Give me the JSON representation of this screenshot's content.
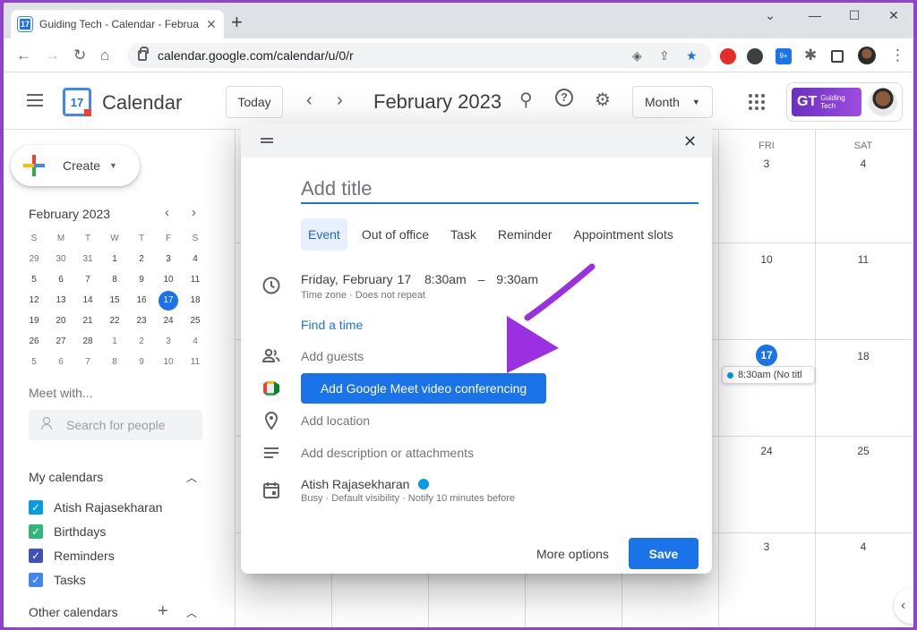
{
  "browser": {
    "tab_title": "Guiding Tech - Calendar - Februa",
    "favicon_text": "17",
    "url": "calendar.google.com/calendar/u/0/r",
    "extension_badge": "9+"
  },
  "header": {
    "app_name": "Calendar",
    "logo_day": "17",
    "today_label": "Today",
    "month_title": "February 2023",
    "view_label": "Month",
    "brand_name": "Guiding Tech"
  },
  "sidebar": {
    "create_label": "Create",
    "mini_title": "February 2023",
    "dow": [
      "S",
      "M",
      "T",
      "W",
      "T",
      "F",
      "S"
    ],
    "weeks": [
      [
        "29",
        "30",
        "31",
        "1",
        "2",
        "3",
        "4"
      ],
      [
        "5",
        "6",
        "7",
        "8",
        "9",
        "10",
        "11"
      ],
      [
        "12",
        "13",
        "14",
        "15",
        "16",
        "17",
        "18"
      ],
      [
        "19",
        "20",
        "21",
        "22",
        "23",
        "24",
        "25"
      ],
      [
        "26",
        "27",
        "28",
        "1",
        "2",
        "3",
        "4"
      ],
      [
        "5",
        "6",
        "7",
        "8",
        "9",
        "10",
        "11"
      ]
    ],
    "meet_with": "Meet with...",
    "search_people_placeholder": "Search for people",
    "my_calendars_title": "My calendars",
    "my_calendars": [
      {
        "label": "Atish Rajasekharan",
        "color": "#039be5"
      },
      {
        "label": "Birthdays",
        "color": "#33b679"
      },
      {
        "label": "Reminders",
        "color": "#3f51b5"
      },
      {
        "label": "Tasks",
        "color": "#4285f4"
      }
    ],
    "other_calendars_title": "Other calendars"
  },
  "grid": {
    "dow_labels": [
      "FRI",
      "SAT"
    ],
    "friday_dates": [
      "3",
      "10",
      "17",
      "24",
      "3"
    ],
    "saturday_dates": [
      "4",
      "11",
      "18",
      "25",
      "4"
    ],
    "event_chip": "8:30am (No titl"
  },
  "dialog": {
    "title_placeholder": "Add title",
    "tabs": [
      "Event",
      "Out of office",
      "Task",
      "Reminder",
      "Appointment slots"
    ],
    "date": "Friday, February 17",
    "start": "8:30am",
    "dash": "–",
    "end": "9:30am",
    "time_sub": "Time zone · Does not repeat",
    "find_time": "Find a time",
    "add_guests": "Add guests",
    "meet_button": "Add Google Meet video conferencing",
    "add_location": "Add location",
    "add_description": "Add description or attachments",
    "owner": "Atish Rajasekharan",
    "owner_sub": "Busy · Default visibility · Notify 10 minutes before",
    "more_options": "More options",
    "save": "Save"
  }
}
